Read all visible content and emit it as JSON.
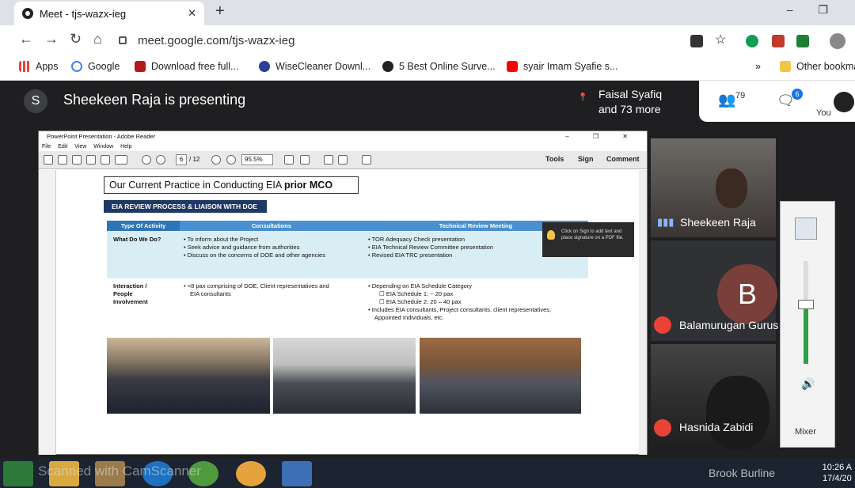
{
  "browser": {
    "tab_title": "Meet - tjs-wazx-ieg",
    "tab_close": "✕",
    "new_tab": "+",
    "url": "meet.google.com/tjs-wazx-ieg",
    "window_controls": "–  ❐"
  },
  "bookmarks": {
    "items": [
      {
        "label": "Apps",
        "color": "#ea4335"
      },
      {
        "label": "Google",
        "color": "#4285f4"
      },
      {
        "label": "Download free full...",
        "color": "#b31b1b"
      },
      {
        "label": "WiseCleaner Downl...",
        "color": "#2c3e99"
      },
      {
        "label": "5 Best Online Surve...",
        "color": "#222222"
      },
      {
        "label": "syair Imam Syafie s...",
        "color": "#ff0000"
      }
    ],
    "overflow": "»",
    "other": "Other bookma"
  },
  "meet": {
    "avatar_letter": "S",
    "presenting_text": "Sheekeen Raja is presenting",
    "others_line1": "Faisal Syafiq",
    "others_line2": "and 73 more",
    "people_count": "79",
    "chat_count": "6",
    "you_label": "You"
  },
  "reader": {
    "title": "PowerPoint Presentation - Adobe Reader",
    "win_controls": "– ❐ ✕",
    "menu": [
      "File",
      "Edit",
      "View",
      "Window",
      "Help"
    ],
    "page_current": "6",
    "page_total": "/ 12",
    "zoom": "95.5%",
    "tools": "Tools",
    "sign": "Sign",
    "comment": "Comment",
    "sign_tip": "Click on Sign to add text and place signature on a PDF file."
  },
  "slide": {
    "title_plain": "Our Current Practice in Conducting EIA ",
    "title_bold": "prior MCO",
    "banner": "EIA REVIEW PROCESS & LIAISON WITH DOE",
    "headers": [
      "Type Of Activity",
      "Consultations",
      "Technical Review Meeting"
    ],
    "row1": {
      "label": "What Do We Do?",
      "consultations": [
        "To inform about the Project",
        "Seek advice and guidance from authorities",
        "Discuss on the concerns of DOE and other agencies"
      ],
      "trm": [
        "TOR Adequacy Check presentation",
        "EIA Technical Review  Committee presentation",
        "Revised EIA TRC presentation"
      ]
    },
    "row2": {
      "label_1": "Interaction /",
      "label_2": "People",
      "label_3": "Involvement",
      "consultations_1": "<8 pax comprising of DOE, Client representatives and",
      "consultations_2": "EIA consultants",
      "trm_1": "Depending on EIA Schedule Category",
      "trm_2": "EIA Schedule 1: ~ 20 pax",
      "trm_3": "EIA Schedule 2:  20 – 40 pax",
      "trm_4": "Includes EIA consultants, Project consultants, client representatives,",
      "trm_5": "Appointed Individuals, etc."
    }
  },
  "participants": {
    "p1": "Sheekeen Raja",
    "p2_letter": "B",
    "p2": "Balamurugan Gurus",
    "p3": "Hasnida Zabidi"
  },
  "mixer": {
    "label": "Mixer",
    "level": 0.58
  },
  "taskbar": {
    "user": "Brook Burline",
    "time": "10:26 A",
    "date": "17/4/20"
  },
  "watermark": "Scanned with CamScanner"
}
